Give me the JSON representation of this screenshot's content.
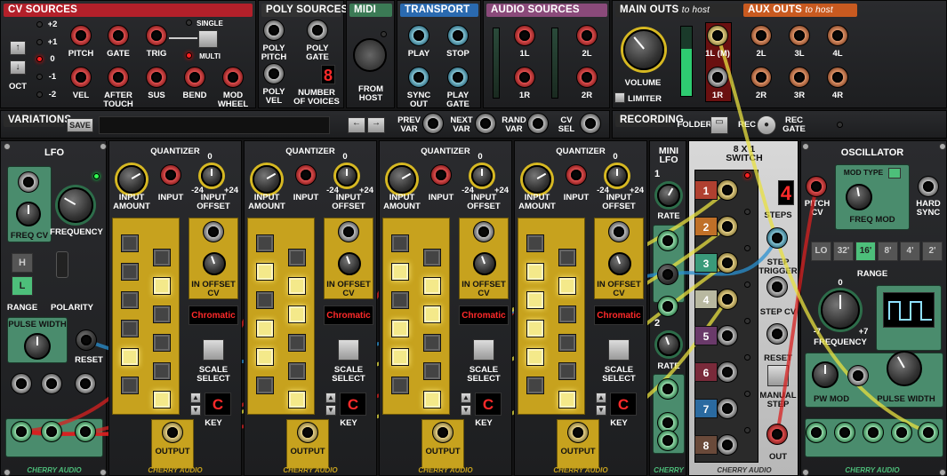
{
  "colors": {
    "cv": "#b3202a",
    "poly": "#2a2a2a",
    "midi": "#3b7a55",
    "transport": "#2a6ab0",
    "audio": "#8a4a7a",
    "main": "#2a2a2a",
    "aux": "#c85a20",
    "cable_red": "#d82020",
    "cable_yellow": "#e8e040",
    "cable_blue": "#2a90d0"
  },
  "top": {
    "cv": {
      "title": "CV SOURCES",
      "octave_label": "OCT",
      "oct_values": [
        "+2",
        "+1",
        "0",
        "-1",
        "-2"
      ],
      "jacks": [
        "PITCH",
        "GATE",
        "TRIG",
        "VEL",
        "AFTER\nTOUCH",
        "SUS",
        "BEND",
        "MOD\nWHEEL"
      ],
      "single": "SINGLE",
      "multi": "MULTI"
    },
    "poly": {
      "title": "POLY SOURCES",
      "jacks": [
        "POLY\nPITCH",
        "POLY\nGATE",
        "POLY\nVEL"
      ],
      "voices_label": "NUMBER\nOF VOICES",
      "voices_value": "8"
    },
    "midi": {
      "title": "MIDI",
      "from_host": "FROM\nHOST"
    },
    "transport": {
      "title": "TRANSPORT",
      "jacks": [
        "PLAY",
        "STOP",
        "SYNC\nOUT",
        "PLAY\nGATE"
      ]
    },
    "audio": {
      "title": "AUDIO SOURCES",
      "jacks": [
        "1L",
        "2L",
        "1R",
        "2R"
      ]
    },
    "main": {
      "title": "MAIN OUTS",
      "suffix": "to host",
      "volume": "VOLUME",
      "limiter": "LIMITER",
      "jacks": [
        "1L (M)",
        "1R"
      ]
    },
    "aux": {
      "title": "AUX OUTS",
      "suffix": "to host",
      "jacks": [
        "2L",
        "3L",
        "4L",
        "2R",
        "3R",
        "4R"
      ]
    },
    "variations": {
      "title": "VARIATIONS",
      "save": "SAVE",
      "prev": "PREV\nVAR",
      "next": "NEXT\nVAR",
      "rand": "RAND\nVAR",
      "cvsel": "CV\nSEL"
    },
    "recording": {
      "title": "RECORDING",
      "folder": "FOLDER",
      "rec": "REC",
      "rec_gate": "REC\nGATE"
    }
  },
  "lfo": {
    "title": "LFO",
    "freq_cv": "FREQ CV",
    "frequency": "FREQUENCY",
    "range": "RANGE",
    "h": "H",
    "l": "L",
    "polarity": "POLARITY",
    "pulse_width": "PULSE WIDTH",
    "reset": "RESET",
    "brand": "CHERRY AUDIO"
  },
  "quantizer": {
    "title": "QUANTIZER",
    "input_amount": "INPUT\nAMOUNT",
    "input": "INPUT",
    "input_offset": "INPUT\nOFFSET",
    "offset_min": "-24",
    "offset_max": "+24",
    "offset_zero": "0",
    "in_offset_cv": "IN OFFSET\nCV",
    "scale": "Chromatic",
    "scale_select": "SCALE\nSELECT",
    "key_label": "KEY",
    "key_value": "C",
    "output": "OUTPUT",
    "brand": "CHERRY AUDIO"
  },
  "mini_lfo": {
    "title": "MINI\nLFO",
    "n1": "1",
    "n2": "2",
    "rate": "RATE",
    "brand": "CHERRY"
  },
  "switch": {
    "title": "8 X 1\nSWITCH",
    "steps": "STEPS",
    "steps_value": "4",
    "step_trigger": "STEP\nTRIGGER",
    "step_cv": "STEP CV",
    "reset": "RESET",
    "manual_step": "MANUAL\nSTEP",
    "out": "OUT",
    "inputs": [
      "1",
      "2",
      "3",
      "4",
      "5",
      "6",
      "7",
      "8"
    ],
    "brand": "CHERRY AUDIO"
  },
  "osc": {
    "title": "OSCILLATOR",
    "mod_type": "MOD TYPE",
    "freq_mod": "FREQ MOD",
    "pitch_cv": "PITCH\nCV",
    "hard_sync": "HARD\nSYNC",
    "range": "RANGE",
    "ranges": [
      "LO",
      "32'",
      "16'",
      "8'",
      "4'",
      "2'"
    ],
    "frequency": "FREQUENCY",
    "f_min": "-7",
    "f_max": "+7",
    "f_zero": "0",
    "pw_mod": "PW MOD",
    "pulse_width": "PULSE WIDTH",
    "brand": "CHERRY AUDIO"
  }
}
